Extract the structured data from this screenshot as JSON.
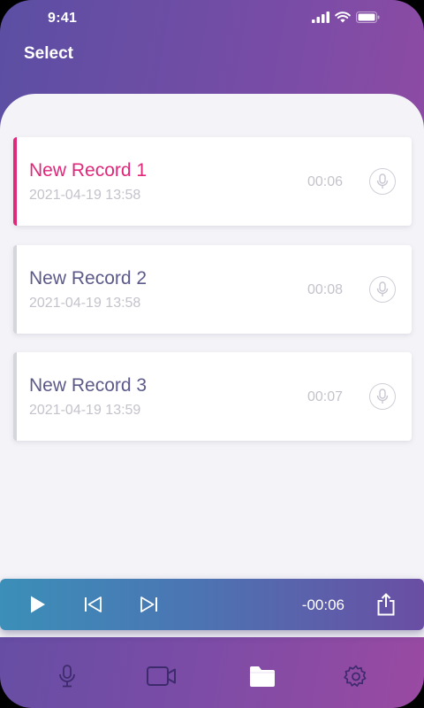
{
  "status_bar": {
    "time": "9:41"
  },
  "header": {
    "select_label": "Select"
  },
  "records": [
    {
      "title": "New Record 1",
      "date": "2021-04-19 13:58",
      "duration": "00:06",
      "active": true
    },
    {
      "title": "New Record 2",
      "date": "2021-04-19 13:58",
      "duration": "00:08",
      "active": false
    },
    {
      "title": "New Record 3",
      "date": "2021-04-19 13:59",
      "duration": "00:07",
      "active": false
    }
  ],
  "player": {
    "remaining_time": "-00:06"
  },
  "tab_bar": {
    "items": [
      {
        "icon": "microphone-icon"
      },
      {
        "icon": "video-camera-icon"
      },
      {
        "icon": "folder-icon",
        "selected": true
      },
      {
        "icon": "gear-icon"
      }
    ]
  },
  "colors": {
    "accent": "#e0287a",
    "title_text": "#5c5a8a",
    "muted_text": "#c3c3cc"
  }
}
